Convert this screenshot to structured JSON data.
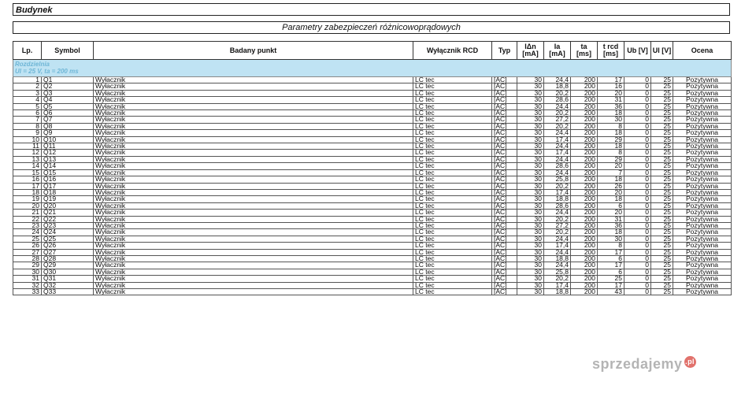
{
  "header": {
    "title": "Budynek",
    "subtitle": "Parametry zabezpieczeń różnicowoprądowych"
  },
  "columns": {
    "lp": "Lp.",
    "symbol": "Symbol",
    "point": "Badany punkt",
    "rcd": "Wyłącznik RCD",
    "typ": "Typ",
    "idn": [
      "IΔn",
      "[mA]"
    ],
    "ia": [
      "Ia",
      "[mA]"
    ],
    "ta": [
      "ta",
      "[ms]"
    ],
    "trcd": [
      "t rcd",
      "[ms]"
    ],
    "ub": "Ub [V]",
    "ul": "Ul [V]",
    "ocena": "Ocena"
  },
  "section": {
    "name": "Rozdzielnia",
    "params": "Ul = 25 V, ta = 200 ms"
  },
  "rows": [
    {
      "lp": "1",
      "symbol": "Q1",
      "point": "Wyłacznik",
      "rcd": "LC tec",
      "typ": "[AC]",
      "idn": "30",
      "ia": "24,4",
      "ta": "200",
      "trcd": "17",
      "ub": "0",
      "ul": "25",
      "ocena": "Pozytywna"
    },
    {
      "lp": "2",
      "symbol": "Q2",
      "point": "Wyłacznik",
      "rcd": "LC tec",
      "typ": "[AC]",
      "idn": "30",
      "ia": "18,8",
      "ta": "200",
      "trcd": "16",
      "ub": "0",
      "ul": "25",
      "ocena": "Pozytywna"
    },
    {
      "lp": "3",
      "symbol": "Q3",
      "point": "Wyłacznik",
      "rcd": "LC tec",
      "typ": "[AC]",
      "idn": "30",
      "ia": "20,2",
      "ta": "200",
      "trcd": "20",
      "ub": "0",
      "ul": "25",
      "ocena": "Pozytywna"
    },
    {
      "lp": "4",
      "symbol": "Q4",
      "point": "Wyłacznik",
      "rcd": "LC tec",
      "typ": "[AC]",
      "idn": "30",
      "ia": "28,6",
      "ta": "200",
      "trcd": "31",
      "ub": "0",
      "ul": "25",
      "ocena": "Pozytywna"
    },
    {
      "lp": "5",
      "symbol": "Q5",
      "point": "Wyłacznik",
      "rcd": "LC tec",
      "typ": "[AC]",
      "idn": "30",
      "ia": "24,4",
      "ta": "200",
      "trcd": "36",
      "ub": "0",
      "ul": "25",
      "ocena": "Pozytywna"
    },
    {
      "lp": "6",
      "symbol": "Q6",
      "point": "Wyłacznik",
      "rcd": "LC tec",
      "typ": "[AC]",
      "idn": "30",
      "ia": "20,2",
      "ta": "200",
      "trcd": "18",
      "ub": "0",
      "ul": "25",
      "ocena": "Pozytywna"
    },
    {
      "lp": "7",
      "symbol": "Q7",
      "point": "Wyłacznik",
      "rcd": "LC tec",
      "typ": "[AC]",
      "idn": "30",
      "ia": "27,2",
      "ta": "200",
      "trcd": "30",
      "ub": "0",
      "ul": "25",
      "ocena": "Pozytywna"
    },
    {
      "lp": "8",
      "symbol": "Q8",
      "point": "Wyłacznik",
      "rcd": "LC tec",
      "typ": "[AC]",
      "idn": "30",
      "ia": "20,2",
      "ta": "200",
      "trcd": "8",
      "ub": "0",
      "ul": "25",
      "ocena": "Pozytywna"
    },
    {
      "lp": "9",
      "symbol": "Q9",
      "point": "Wyłacznik",
      "rcd": "LC tec",
      "typ": "[AC]",
      "idn": "30",
      "ia": "24,4",
      "ta": "200",
      "trcd": "18",
      "ub": "0",
      "ul": "25",
      "ocena": "Pozytywna"
    },
    {
      "lp": "10",
      "symbol": "Q10",
      "point": "Wyłacznik",
      "rcd": "LC tec",
      "typ": "[AC]",
      "idn": "30",
      "ia": "17,4",
      "ta": "200",
      "trcd": "29",
      "ub": "0",
      "ul": "25",
      "ocena": "Pozytywna"
    },
    {
      "lp": "11",
      "symbol": "Q11",
      "point": "Wyłacznik",
      "rcd": "LC tec",
      "typ": "[AC]",
      "idn": "30",
      "ia": "24,4",
      "ta": "200",
      "trcd": "18",
      "ub": "0",
      "ul": "25",
      "ocena": "Pozytywna"
    },
    {
      "lp": "12",
      "symbol": "Q12",
      "point": "Wyłacznik",
      "rcd": "LC tec",
      "typ": "[AC]",
      "idn": "30",
      "ia": "17,4",
      "ta": "200",
      "trcd": "8",
      "ub": "0",
      "ul": "25",
      "ocena": "Pozytywna"
    },
    {
      "lp": "13",
      "symbol": "Q13",
      "point": "Wyłacznik",
      "rcd": "LC tec",
      "typ": "[AC]",
      "idn": "30",
      "ia": "24,4",
      "ta": "200",
      "trcd": "29",
      "ub": "0",
      "ul": "25",
      "ocena": "Pozytywna"
    },
    {
      "lp": "14",
      "symbol": "Q14",
      "point": "Wyłacznik",
      "rcd": "LC tec",
      "typ": "[AC]",
      "idn": "30",
      "ia": "28,6",
      "ta": "200",
      "trcd": "20",
      "ub": "0",
      "ul": "25",
      "ocena": "Pozytywna"
    },
    {
      "lp": "15",
      "symbol": "Q15",
      "point": "Wyłacznik",
      "rcd": "LC tec",
      "typ": "[AC]",
      "idn": "30",
      "ia": "24,4",
      "ta": "200",
      "trcd": "7",
      "ub": "0",
      "ul": "25",
      "ocena": "Pozytywna"
    },
    {
      "lp": "16",
      "symbol": "Q16",
      "point": "Wyłacznik",
      "rcd": "LC tec",
      "typ": "[AC]",
      "idn": "30",
      "ia": "25,8",
      "ta": "200",
      "trcd": "18",
      "ub": "0",
      "ul": "25",
      "ocena": "Pozytywna"
    },
    {
      "lp": "17",
      "symbol": "Q17",
      "point": "Wyłacznik",
      "rcd": "LC tec",
      "typ": "[AC]",
      "idn": "30",
      "ia": "20,2",
      "ta": "200",
      "trcd": "26",
      "ub": "0",
      "ul": "25",
      "ocena": "Pozytywna"
    },
    {
      "lp": "18",
      "symbol": "Q18",
      "point": "Wyłacznik",
      "rcd": "LC tec",
      "typ": "[AC]",
      "idn": "30",
      "ia": "17,4",
      "ta": "200",
      "trcd": "20",
      "ub": "0",
      "ul": "25",
      "ocena": "Pozytywna"
    },
    {
      "lp": "19",
      "symbol": "Q19",
      "point": "Wyłacznik",
      "rcd": "LC tec",
      "typ": "[AC]",
      "idn": "30",
      "ia": "18,8",
      "ta": "200",
      "trcd": "18",
      "ub": "0",
      "ul": "25",
      "ocena": "Pozytywna"
    },
    {
      "lp": "20",
      "symbol": "Q20",
      "point": "Wyłacznik",
      "rcd": "LC tec",
      "typ": "[AC]",
      "idn": "30",
      "ia": "28,6",
      "ta": "200",
      "trcd": "6",
      "ub": "0",
      "ul": "25",
      "ocena": "Pozytywna"
    },
    {
      "lp": "21",
      "symbol": "Q21",
      "point": "Wyłacznik",
      "rcd": "LC tec",
      "typ": "[AC]",
      "idn": "30",
      "ia": "24,4",
      "ta": "200",
      "trcd": "20",
      "ub": "0",
      "ul": "25",
      "ocena": "Pozytywna"
    },
    {
      "lp": "22",
      "symbol": "Q22",
      "point": "Wyłacznik",
      "rcd": "LC tec",
      "typ": "[AC]",
      "idn": "30",
      "ia": "20,2",
      "ta": "200",
      "trcd": "31",
      "ub": "0",
      "ul": "25",
      "ocena": "Pozytywna"
    },
    {
      "lp": "23",
      "symbol": "Q23",
      "point": "Wyłacznik",
      "rcd": "LC tec",
      "typ": "[AC]",
      "idn": "30",
      "ia": "27,2",
      "ta": "200",
      "trcd": "36",
      "ub": "0",
      "ul": "25",
      "ocena": "Pozytywna"
    },
    {
      "lp": "24",
      "symbol": "Q24",
      "point": "Wyłacznik",
      "rcd": "LC tec",
      "typ": "[AC]",
      "idn": "30",
      "ia": "20,2",
      "ta": "200",
      "trcd": "18",
      "ub": "0",
      "ul": "25",
      "ocena": "Pozytywna"
    },
    {
      "lp": "25",
      "symbol": "Q25",
      "point": "Wyłacznik",
      "rcd": "LC tec",
      "typ": "[AC]",
      "idn": "30",
      "ia": "24,4",
      "ta": "200",
      "trcd": "30",
      "ub": "0",
      "ul": "25",
      "ocena": "Pozytywna"
    },
    {
      "lp": "26",
      "symbol": "Q26",
      "point": "Wyłacznik",
      "rcd": "LC tec",
      "typ": "[AC]",
      "idn": "30",
      "ia": "17,4",
      "ta": "200",
      "trcd": "8",
      "ub": "0",
      "ul": "25",
      "ocena": "Pozytywna"
    },
    {
      "lp": "27",
      "symbol": "Q27",
      "point": "Wyłacznik",
      "rcd": "LC tec",
      "typ": "[AC]",
      "idn": "30",
      "ia": "24,4",
      "ta": "200",
      "trcd": "17",
      "ub": "0",
      "ul": "25",
      "ocena": "Pozytywna"
    },
    {
      "lp": "28",
      "symbol": "Q28",
      "point": "Wyłacznik",
      "rcd": "LC tec",
      "typ": "[AC]",
      "idn": "30",
      "ia": "18,8",
      "ta": "200",
      "trcd": "6",
      "ub": "0",
      "ul": "25",
      "ocena": "Pozytywna"
    },
    {
      "lp": "29",
      "symbol": "Q29",
      "point": "Wyłacznik",
      "rcd": "LC tec",
      "typ": "[AC]",
      "idn": "30",
      "ia": "24,4",
      "ta": "200",
      "trcd": "17",
      "ub": "0",
      "ul": "25",
      "ocena": "Pozytywna"
    },
    {
      "lp": "30",
      "symbol": "Q30",
      "point": "Wyłacznik",
      "rcd": "LC tec",
      "typ": "[AC]",
      "idn": "30",
      "ia": "25,8",
      "ta": "200",
      "trcd": "6",
      "ub": "0",
      "ul": "25",
      "ocena": "Pozytywna"
    },
    {
      "lp": "31",
      "symbol": "Q31",
      "point": "Wyłacznik",
      "rcd": "LC tec",
      "typ": "[AC]",
      "idn": "30",
      "ia": "20,2",
      "ta": "200",
      "trcd": "25",
      "ub": "0",
      "ul": "25",
      "ocena": "Pozytywna"
    },
    {
      "lp": "32",
      "symbol": "Q32",
      "point": "Wyłacznik",
      "rcd": "LC tec",
      "typ": "[AC]",
      "idn": "30",
      "ia": "17,4",
      "ta": "200",
      "trcd": "17",
      "ub": "0",
      "ul": "25",
      "ocena": "Pozytywna"
    },
    {
      "lp": "33",
      "symbol": "Q33",
      "point": "Wyłacznik",
      "rcd": "LC tec",
      "typ": "[AC]",
      "idn": "30",
      "ia": "18,8",
      "ta": "200",
      "trcd": "43",
      "ub": "0",
      "ul": "25",
      "ocena": "Pozytywna"
    }
  ],
  "watermark": {
    "text": "sprzedajemy",
    "badge": ".pl"
  }
}
